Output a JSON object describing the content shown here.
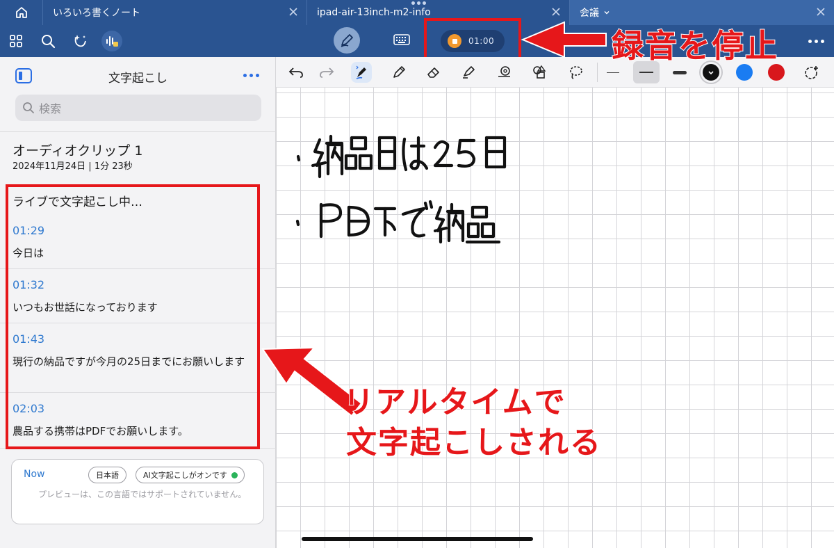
{
  "tabs": [
    {
      "label": "いろいろ書くノート"
    },
    {
      "label": "ipad-air-13inch-m2-info"
    },
    {
      "label": "会議"
    }
  ],
  "recording": {
    "time": "01:00"
  },
  "sidebar": {
    "title": "文字起こし",
    "search_placeholder": "検索",
    "clip": {
      "title": "オーディオクリップ 1",
      "meta": "2024年11月24日 | 1分 23秒"
    },
    "live_header": "ライブで文字起こし中…",
    "entries": [
      {
        "time": "01:29",
        "text": "今日は"
      },
      {
        "time": "01:32",
        "text": "いつもお世話になっております"
      },
      {
        "time": "01:43",
        "text": "現行の納品ですが今月の25日までにお願いします"
      },
      {
        "time": "02:03",
        "text": "農品する携帯はPDFでお願いします。"
      }
    ],
    "now": {
      "label": "Now",
      "language": "日本語",
      "ai_status": "AI文字起こしがオンです",
      "note": "プレビューは、この言語ではサポートされていません。"
    }
  },
  "colors": {
    "black": "#111111",
    "blue": "#1a7cf2",
    "red": "#d8171c",
    "accent": "#2a5491",
    "annotation": "#e6171a"
  },
  "handwriting": [
    "・納品日は25日",
    "・PDFで納品"
  ],
  "annotations": {
    "stop_recording": "録音を停止",
    "realtime_line1": "リアルタイムで",
    "realtime_line2": "文字起こしされる"
  }
}
